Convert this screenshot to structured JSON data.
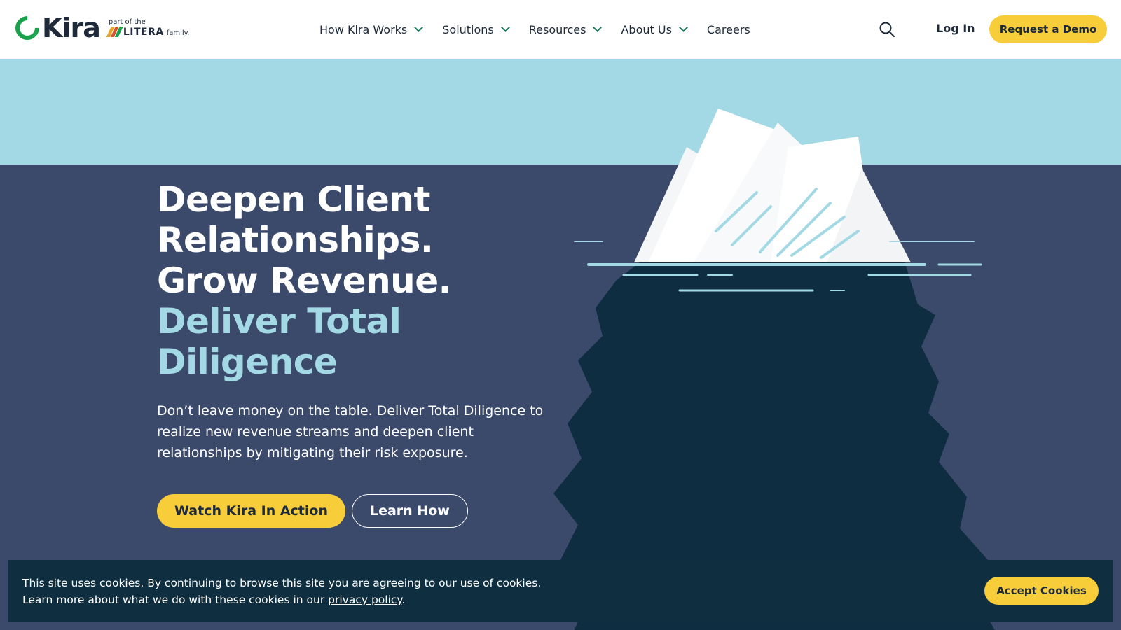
{
  "brand": {
    "name": "Kira",
    "tagline_top": "part of the",
    "tagline_name": "LITERA",
    "tagline_suffix": "family.",
    "colors": {
      "green": "#19a14b",
      "navy": "#1e2a3a",
      "yellow": "#f7cd3a",
      "sky": "#a3d9e5",
      "sea": "#3b4a6b",
      "banner": "#0f2f40"
    }
  },
  "nav": {
    "items": [
      {
        "label": "How Kira Works",
        "has_dropdown": true
      },
      {
        "label": "Solutions",
        "has_dropdown": true
      },
      {
        "label": "Resources",
        "has_dropdown": true
      },
      {
        "label": "About Us",
        "has_dropdown": true
      },
      {
        "label": "Careers",
        "has_dropdown": false
      }
    ],
    "search_icon": "search-icon",
    "login_label": "Log In",
    "demo_label": "Request a Demo"
  },
  "hero": {
    "headline_line1": "Deepen Client",
    "headline_line2": "Relationships.",
    "headline_line3": "Grow Revenue.",
    "headline_accent": "Deliver Total Diligence",
    "subtext": "Don’t leave money on the table. Deliver Total Diligence to realize new revenue streams and deepen client relationships by mitigating their risk exposure.",
    "cta_primary": "Watch Kira In Action",
    "cta_secondary": "Learn How",
    "illustration": "iceberg-of-documents"
  },
  "cookie": {
    "line1": "This site uses cookies. By continuing to browse this site you are agreeing to our use of cookies.",
    "line2_prefix": "Learn more about what we do with these cookies in our ",
    "link_label": "privacy policy",
    "line2_suffix": ".",
    "accept_label": "Accept Cookies"
  }
}
